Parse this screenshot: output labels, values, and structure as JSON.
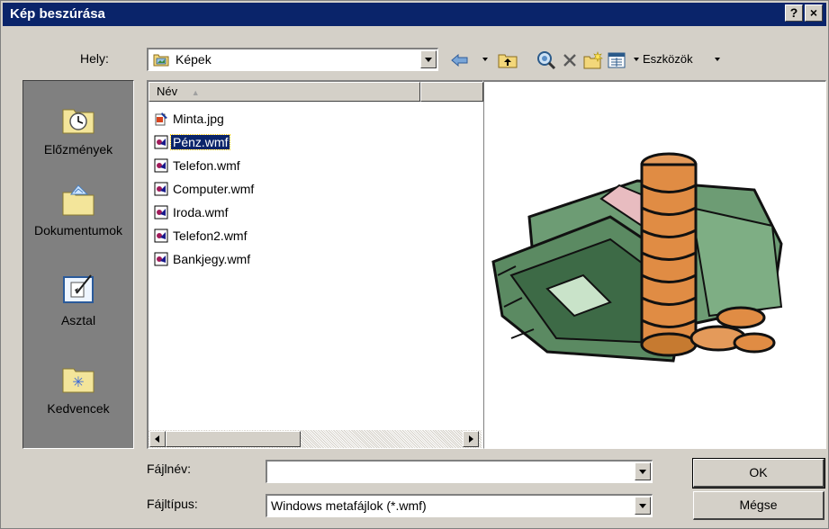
{
  "window": {
    "title": "Kép beszúrása",
    "help_button": "?",
    "close_button": "×"
  },
  "toolbar": {
    "location_label": "Hely:",
    "location_value": "Képek",
    "tools_label": "Eszközök"
  },
  "places": [
    {
      "label": "Előzmények",
      "icon": "history-icon"
    },
    {
      "label": "Dokumentumok",
      "icon": "my-documents-icon"
    },
    {
      "label": "Asztal",
      "icon": "desktop-icon"
    },
    {
      "label": "Kedvencek",
      "icon": "favorites-icon"
    }
  ],
  "filelist": {
    "column_name": "Név",
    "sort_indicator": "▲",
    "files": [
      {
        "name": "Minta.jpg",
        "type": "jpg"
      },
      {
        "name": "Pénz.wmf",
        "type": "wmf",
        "selected": true
      },
      {
        "name": "Telefon.wmf",
        "type": "wmf"
      },
      {
        "name": "Computer.wmf",
        "type": "wmf"
      },
      {
        "name": "Iroda.wmf",
        "type": "wmf"
      },
      {
        "name": "Telefon2.wmf",
        "type": "wmf"
      },
      {
        "name": "Bankjegy.wmf",
        "type": "wmf"
      }
    ]
  },
  "preview": {
    "image": "money-clipart"
  },
  "bottom": {
    "filename_label": "Fájlnév:",
    "filename_value": "",
    "filetype_label": "Fájltípus:",
    "filetype_value": "Windows metafájlok (*.wmf)",
    "ok_label": "OK",
    "cancel_label": "Mégse"
  },
  "colors": {
    "titlebar": "#0a246a",
    "dialog_face": "#d4d0c8",
    "selection": "#0a246a"
  }
}
